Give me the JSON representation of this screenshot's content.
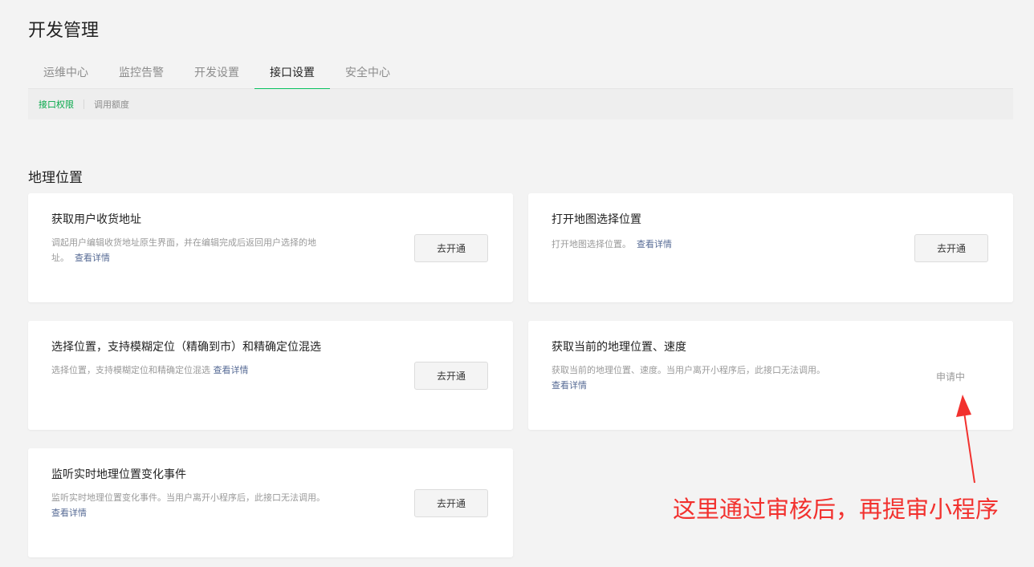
{
  "page_title": "开发管理",
  "main_tabs": [
    {
      "label": "运维中心"
    },
    {
      "label": "监控告警"
    },
    {
      "label": "开发设置"
    },
    {
      "label": "接口设置"
    },
    {
      "label": "安全中心"
    }
  ],
  "sub_tabs": [
    {
      "label": "接口权限"
    },
    {
      "label": "调用额度"
    }
  ],
  "section_title": "地理位置",
  "cards": [
    {
      "title": "获取用户收货地址",
      "desc_line1": "调起用户编辑收货地址原生界面，并在编辑完成后返回用户选择的地",
      "desc_line2": "址。",
      "link": "查看详情",
      "button": "去开通"
    },
    {
      "title": "打开地图选择位置",
      "desc_line1": "打开地图选择位置。",
      "link": "查看详情",
      "button": "去开通"
    },
    {
      "title": "选择位置，支持模糊定位（精确到市）和精确定位混选",
      "desc_line1": "选择位置，支持模糊定位和精确定位混选",
      "link": "查看详情",
      "button": "去开通"
    },
    {
      "title": "获取当前的地理位置、速度",
      "desc_line1": "获取当前的地理位置、速度。当用户离开小程序后，此接口无法调用。",
      "link": "查看详情",
      "status": "申请中"
    },
    {
      "title": "监听实时地理位置变化事件",
      "desc_line1": "监听实时地理位置变化事件。当用户离开小程序后，此接口无法调用。",
      "link": "查看详情",
      "button": "去开通"
    }
  ],
  "annotation": "这里通过审核后，再提审小程序",
  "colors": {
    "accent_green": "#07c160",
    "link_blue": "#576b95",
    "annotation_red": "#f2312e"
  }
}
